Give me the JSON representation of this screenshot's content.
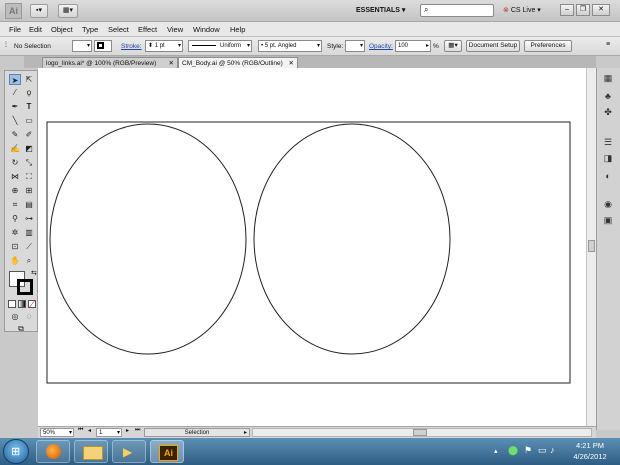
{
  "app": {
    "logo_text": "Ai"
  },
  "titlebar": {
    "workspace": "ESSENTIALS",
    "cs_live": "CS Live",
    "search_placeholder": ""
  },
  "menu": [
    "File",
    "Edit",
    "Object",
    "Type",
    "Select",
    "Effect",
    "View",
    "Window",
    "Help"
  ],
  "control_bar": {
    "selection_label": "No Selection",
    "stroke_label": "Stroke:",
    "stroke_value": "1 pt",
    "uniform_label": "Uniform",
    "brush_label": "5 pt. Angled",
    "style_label": "Style:",
    "opacity_label": "Opacity:",
    "opacity_value": "100",
    "percent_sign": "%",
    "document_setup": "Document Setup",
    "preferences": "Preferences"
  },
  "tabs": [
    {
      "label": "logo_links.ai* @ 100% (RGB/Preview)",
      "active": false
    },
    {
      "label": "CM_Body.ai @ 50% (RGB/Outline)",
      "active": true
    }
  ],
  "status_bar": {
    "zoom": "50%",
    "artboard": "1",
    "tool": "Selection"
  },
  "taskbar": {
    "time": "4:21 PM",
    "date": "4/26/2012",
    "active_app_label": "Ai"
  },
  "colors": {
    "canvas_bg": "#ffffff",
    "stroke": "#222222",
    "taskbar": "#2e5d84",
    "link": "#2244aa"
  }
}
